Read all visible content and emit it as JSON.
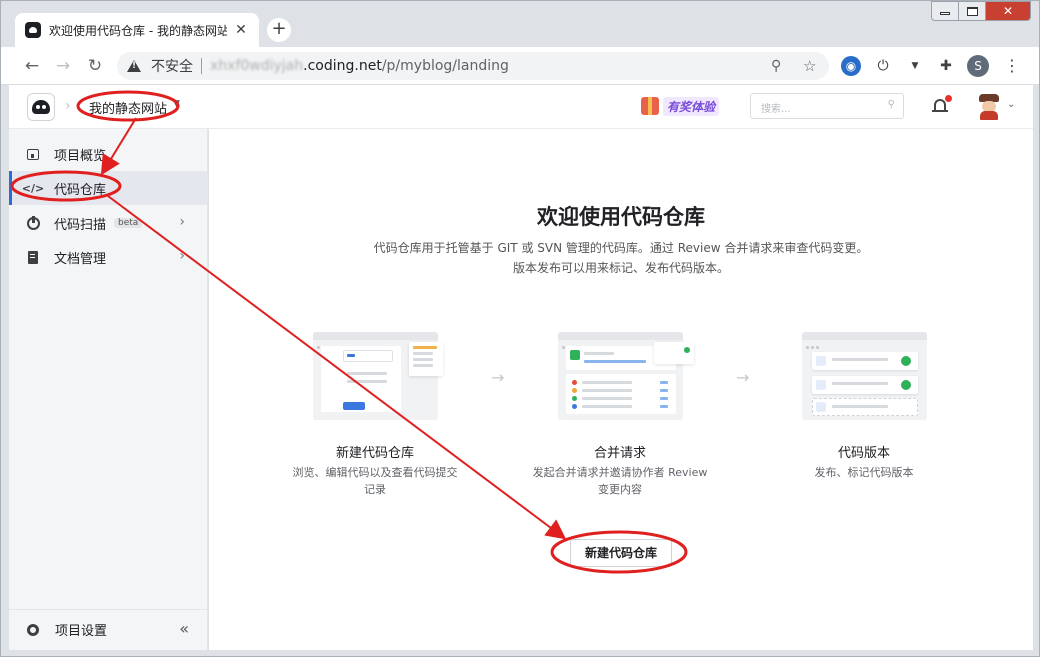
{
  "browser": {
    "tab_title": "欢迎使用代码仓库 - 我的静态网站",
    "tab_close": "✕",
    "new_tab": "+",
    "security_label": "不安全",
    "url_blurred": "xhxf0wdiyjah",
    "url_domain": ".coding.net",
    "url_path": "/p/myblog/landing",
    "profile_initial": "S"
  },
  "header": {
    "project_name": "我的静态网站",
    "promo_text": "有奖体验",
    "search_placeholder": "搜索..."
  },
  "sidebar": {
    "items": [
      {
        "label": "项目概览"
      },
      {
        "label": "代码仓库"
      },
      {
        "label": "代码扫描",
        "badge": "beta"
      },
      {
        "label": "文档管理"
      }
    ],
    "settings_label": "项目设置"
  },
  "main": {
    "title": "欢迎使用代码仓库",
    "description_line1": "代码仓库用于托管基于 GIT 或 SVN 管理的代码库。通过 Review 合并请求来审查代码变更。",
    "description_line2": "版本发布可以用来标记、发布代码版本。",
    "cards": [
      {
        "title": "新建代码仓库",
        "desc_line1": "浏览、编辑代码以及查看代码提交",
        "desc_line2": "记录"
      },
      {
        "title": "合并请求",
        "desc_line1": "发起合并请求并邀请协作者 Review",
        "desc_line2": "变更内容"
      },
      {
        "title": "代码版本",
        "desc_line1": "发布、标记代码版本",
        "desc_line2": ""
      }
    ],
    "create_button": "新建代码仓库"
  },
  "colors": {
    "accent": "#2c6bd8",
    "annotation_red": "#e0201e",
    "window_close": "#c84031"
  }
}
